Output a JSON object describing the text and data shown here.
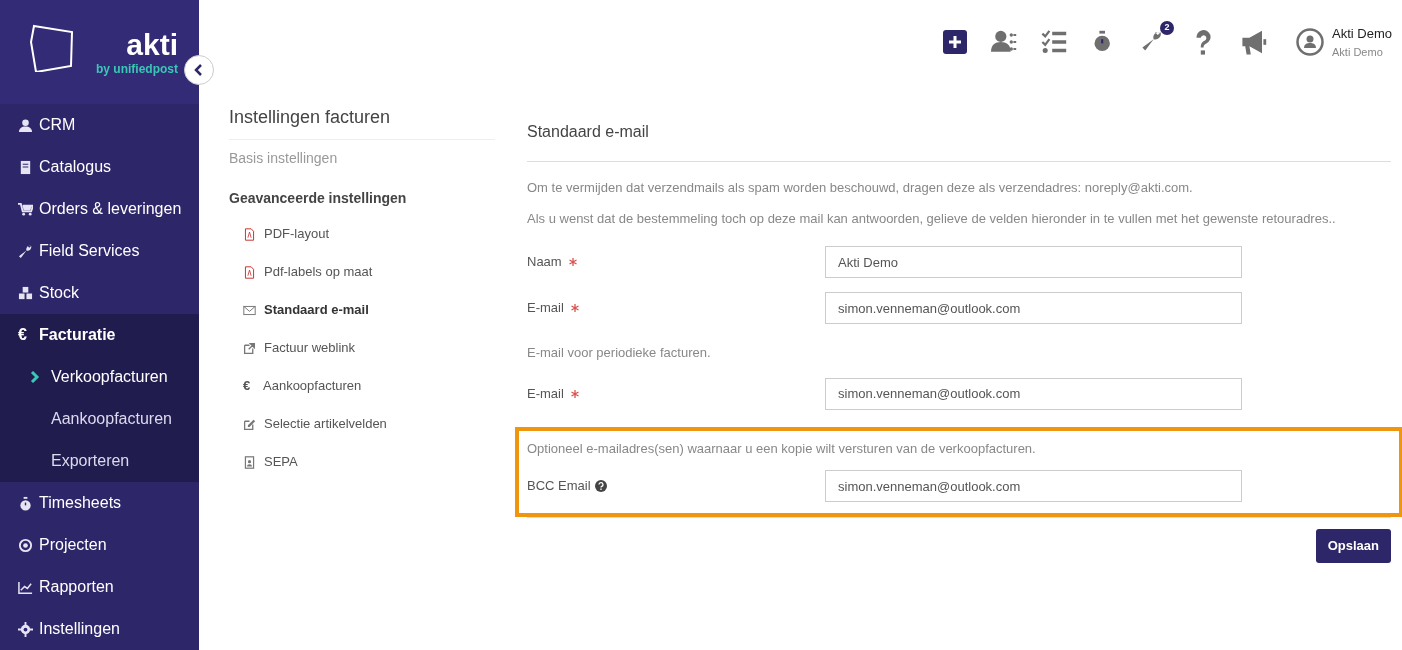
{
  "logo": {
    "name": "akti",
    "tagline": "by unifiedpost"
  },
  "sidebar": {
    "items": [
      {
        "label": "CRM",
        "kind": "user",
        "selected": false
      },
      {
        "label": "Catalogus",
        "kind": "book",
        "selected": false
      },
      {
        "label": "Orders & leveringen",
        "kind": "cart",
        "selected": false
      },
      {
        "label": "Field Services",
        "kind": "wrench",
        "selected": false
      },
      {
        "label": "Stock",
        "kind": "cubes",
        "selected": false
      },
      {
        "label": "Facturatie",
        "glyph": "€",
        "selected": true,
        "children": [
          {
            "label": "Verkoopfacturen",
            "selected": true
          },
          {
            "label": "Aankoopfacturen",
            "selected": false
          },
          {
            "label": "Exporteren",
            "selected": false
          }
        ]
      },
      {
        "label": "Timesheets",
        "kind": "stopwatch",
        "selected": false
      },
      {
        "label": "Projecten",
        "kind": "target",
        "selected": false
      },
      {
        "label": "Rapporten",
        "kind": "chart",
        "selected": false
      },
      {
        "label": "Instellingen",
        "kind": "gear",
        "selected": false
      }
    ]
  },
  "topbar": {
    "tools": [
      {
        "kind": "plus"
      },
      {
        "kind": "contacts"
      },
      {
        "kind": "tasks"
      },
      {
        "kind": "stopwatch"
      },
      {
        "kind": "wrench",
        "badge": "2"
      },
      {
        "kind": "question"
      },
      {
        "kind": "megaphone"
      }
    ],
    "user": {
      "name": "Akti Demo",
      "company": "Akti Demo"
    }
  },
  "settings_nav": {
    "title": "Instellingen facturen",
    "items": [
      {
        "label": "Basis instellingen",
        "selected": false
      },
      {
        "label": "Geavanceerde instellingen",
        "selected": true,
        "children": [
          {
            "label": "PDF-layout",
            "kind": "pdf",
            "selected": false
          },
          {
            "label": "Pdf-labels op maat",
            "kind": "pdf",
            "selected": false
          },
          {
            "label": "Standaard e-mail",
            "kind": "envelope",
            "selected": true
          },
          {
            "label": "Factuur weblink",
            "kind": "external",
            "selected": false
          },
          {
            "label": "Aankoopfacturen",
            "glyph": "€",
            "selected": false
          },
          {
            "label": "Selectie artikelvelden",
            "kind": "pencil",
            "selected": false
          },
          {
            "label": "SEPA",
            "kind": "idcard",
            "selected": false
          }
        ]
      }
    ]
  },
  "form": {
    "title": "Standaard e-mail",
    "intro": [
      "Om te vermijden dat verzendmails als spam worden beschouwd, dragen deze als verzendadres: noreply@akti.com.",
      "Als u wenst dat de bestemmeling toch op deze mail kan antwoorden, gelieve de velden hieronder in te vullen met het gewenste retouradres.."
    ],
    "sections": [
      {
        "fields": [
          {
            "label": "Naam",
            "required": true,
            "value": "Akti Demo"
          },
          {
            "label": "E-mail",
            "required": true,
            "value": "simon.venneman@outlook.com"
          }
        ]
      },
      {
        "note": "E-mail voor periodieke facturen.",
        "fields": [
          {
            "label": "E-mail",
            "required": true,
            "value": "simon.venneman@outlook.com"
          }
        ]
      },
      {
        "note": "Optioneel e-mailadres(sen) waarnaar u een kopie wilt versturen van de verkoopfacturen.",
        "highlighted": true,
        "fields": [
          {
            "label": "BCC Email",
            "help": true,
            "value": "simon.venneman@outlook.com"
          }
        ]
      }
    ],
    "save_button": "Opslaan"
  }
}
